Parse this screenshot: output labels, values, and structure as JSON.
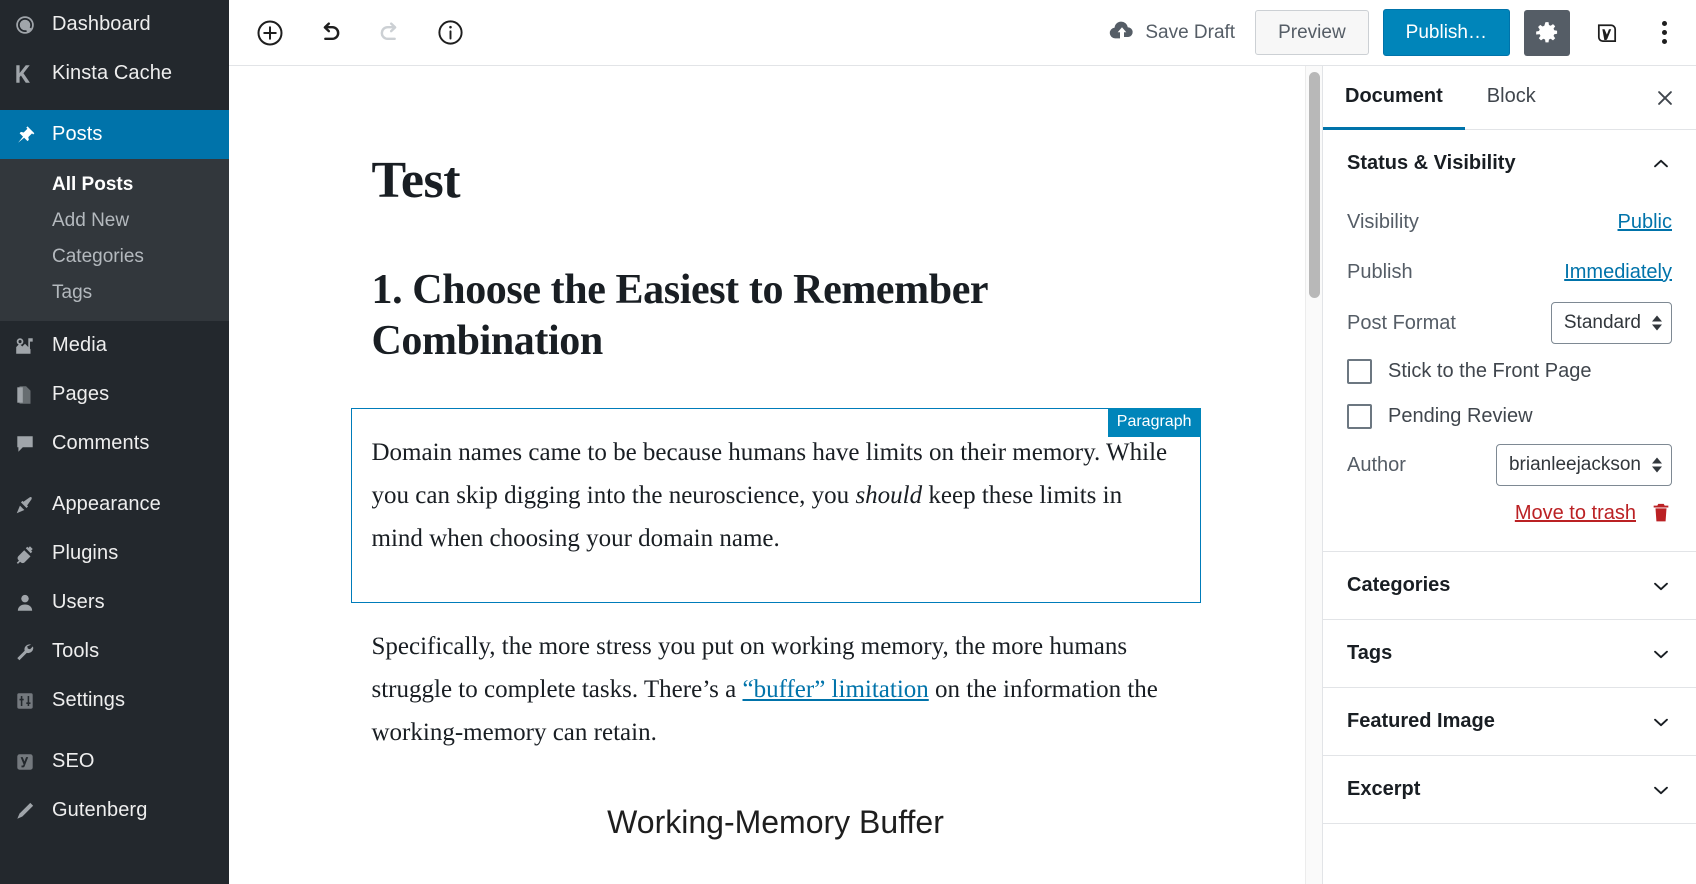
{
  "admin_menu": {
    "items": [
      {
        "label": "Dashboard",
        "icon": "dashboard-icon",
        "current": false
      },
      {
        "label": "Kinsta Cache",
        "icon": "kinsta-icon",
        "current": false
      },
      {
        "label": "Posts",
        "icon": "pin-icon",
        "current": true
      },
      {
        "label": "Media",
        "icon": "media-icon",
        "current": false
      },
      {
        "label": "Pages",
        "icon": "pages-icon",
        "current": false
      },
      {
        "label": "Comments",
        "icon": "comments-icon",
        "current": false
      },
      {
        "label": "Appearance",
        "icon": "paintbrush-icon",
        "current": false
      },
      {
        "label": "Plugins",
        "icon": "plug-icon",
        "current": false
      },
      {
        "label": "Users",
        "icon": "user-icon",
        "current": false
      },
      {
        "label": "Tools",
        "icon": "wrench-icon",
        "current": false
      },
      {
        "label": "Settings",
        "icon": "sliders-icon",
        "current": false
      },
      {
        "label": "SEO",
        "icon": "yoast-icon",
        "current": false
      },
      {
        "label": "Gutenberg",
        "icon": "pencil-icon",
        "current": false
      }
    ],
    "posts_submenu": [
      {
        "label": "All Posts",
        "current": true
      },
      {
        "label": "Add New",
        "current": false
      },
      {
        "label": "Categories",
        "current": false
      },
      {
        "label": "Tags",
        "current": false
      }
    ],
    "colors": {
      "background": "#23282d",
      "submenu_background": "#32373c",
      "current": "#0073aa"
    }
  },
  "toolbar": {
    "add_block_label": "Add block",
    "undo_label": "Undo",
    "redo_label": "Redo",
    "info_label": "Content structure",
    "save_draft_label": "Save Draft",
    "preview_label": "Preview",
    "publish_label": "Publish…",
    "settings_label": "Settings",
    "yoast_label": "Yoast SEO",
    "more_label": "More tools & options",
    "publish_color": "#0085ba"
  },
  "post": {
    "title": "Test",
    "heading": "1. Choose the Easiest to Remember Combination",
    "selected_block": {
      "badge": "Paragraph",
      "text_part1": "Domain names came to be because humans have limits on their memory. While you can skip digging into the neuroscience, you ",
      "text_emphasis": "should",
      "text_part2": " keep these limits in mind when choosing your domain name."
    },
    "paragraph2": {
      "text_part1": "Specifically, the more stress you put on working memory, the more humans struggle to complete tasks. There’s a ",
      "link_text": "“buffer” limitation",
      "text_part2": " on the information the working-memory can retain."
    },
    "image_title": "Working-Memory Buffer"
  },
  "settings": {
    "tabs": [
      {
        "label": "Document",
        "active": true
      },
      {
        "label": "Block",
        "active": false
      }
    ],
    "close_label": "Close settings",
    "status_visibility": {
      "title": "Status & Visibility",
      "rows": [
        {
          "label": "Visibility",
          "value": "Public",
          "type": "link"
        },
        {
          "label": "Publish",
          "value": "Immediately",
          "type": "link"
        },
        {
          "label": "Post Format",
          "value": "Standard",
          "type": "select"
        }
      ],
      "checkboxes": [
        {
          "label": "Stick to the Front Page",
          "checked": false
        },
        {
          "label": "Pending Review",
          "checked": false
        }
      ],
      "author": {
        "label": "Author",
        "value": "brianleejackson"
      },
      "trash_label": "Move to trash",
      "trash_color": "#bb2124"
    },
    "panels": [
      {
        "title": "Categories"
      },
      {
        "title": "Tags"
      },
      {
        "title": "Featured Image"
      },
      {
        "title": "Excerpt"
      }
    ],
    "accent_color": "#0073aa"
  }
}
